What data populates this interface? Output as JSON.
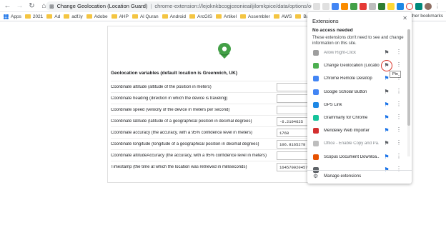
{
  "omnibox": {
    "title": "Change Geolocation (Location Guard)",
    "url": "chrome-extension://lejoknkbcogjceonieailjilomkpice/data/options/option..."
  },
  "bookmarks": [
    {
      "label": "Apps"
    },
    {
      "label": "2021"
    },
    {
      "label": "Ad"
    },
    {
      "label": "adf.ly"
    },
    {
      "label": "Adobe"
    },
    {
      "label": "AHP"
    },
    {
      "label": "Al Quran"
    },
    {
      "label": "Android"
    },
    {
      "label": "ArcGIS"
    },
    {
      "label": "Artikel"
    },
    {
      "label": "Assembler"
    },
    {
      "label": "AWS"
    },
    {
      "label": "Baha"
    }
  ],
  "other_bookmarks": "Other bookmarks",
  "page": {
    "section_title": "Geolocation variables (default location is Greenwich, UK)",
    "rows": [
      {
        "label": "Coordinate altitude (altitude of the position in meters)",
        "value": ""
      },
      {
        "label": "Coordinate heading (direction in which the device is traveling)",
        "value": ""
      },
      {
        "label": "Coordinate speed (velocity of the device in meters per second)",
        "value": ""
      },
      {
        "label": "Coordinate latitude (latitude of a geographical position in decimal degrees)",
        "value": "-6.2104625"
      },
      {
        "label": "Coordinate accuracy (the accuracy, with a 95% confidence level in meters)",
        "value": "1768"
      },
      {
        "label": "Coordinate longitude (longitude of a geographical position in decimal degrees)",
        "value": "106.8165278"
      },
      {
        "label": "Coordinate altitudeAccuracy (the accuracy, with a 95% confidence level in meters)",
        "value": ""
      },
      {
        "label": "Timestamp (the time at which the location was retrieved in milliseconds)",
        "value": "1645709204575"
      }
    ]
  },
  "popup": {
    "title": "Extensions",
    "no_access": "No access needed",
    "description": "These extensions don't need to see and change information on this site.",
    "tooltip": "Pin",
    "extensions": [
      {
        "name": "Allow Right-Click",
        "icon_color": "#9e9e9e",
        "pinned": false,
        "greyed": true
      },
      {
        "name": "Change Geolocation (Locatio...",
        "icon_color": "#4caf50",
        "pinned": false,
        "greyed": false
      },
      {
        "name": "Chrome Remote Desktop",
        "icon_color": "#4285f4",
        "pinned": true,
        "greyed": false
      },
      {
        "name": "Google Scholar Button",
        "icon_color": "#4285f4",
        "pinned": false,
        "greyed": false
      },
      {
        "name": "GPS Link",
        "icon_color": "#1e88e5",
        "pinned": true,
        "greyed": false
      },
      {
        "name": "Grammarly for Chrome",
        "icon_color": "#15c39a",
        "pinned": true,
        "greyed": false
      },
      {
        "name": "Mendeley Web Importer",
        "icon_color": "#d32f2f",
        "pinned": true,
        "greyed": false
      },
      {
        "name": "Office - Enable Copy and Pa...",
        "icon_color": "#bdbdbd",
        "pinned": false,
        "greyed": true
      },
      {
        "name": "Scopus Document Downloa...",
        "icon_color": "#e65100",
        "pinned": true,
        "greyed": false
      },
      {
        "name": "",
        "icon_color": "#5f6368",
        "pinned": true,
        "greyed": false
      }
    ],
    "manage": "Manage extensions"
  },
  "colors": {
    "pin_active": "#1a73e8",
    "pin_inactive": "#5f6368",
    "highlight": "#d93025"
  }
}
